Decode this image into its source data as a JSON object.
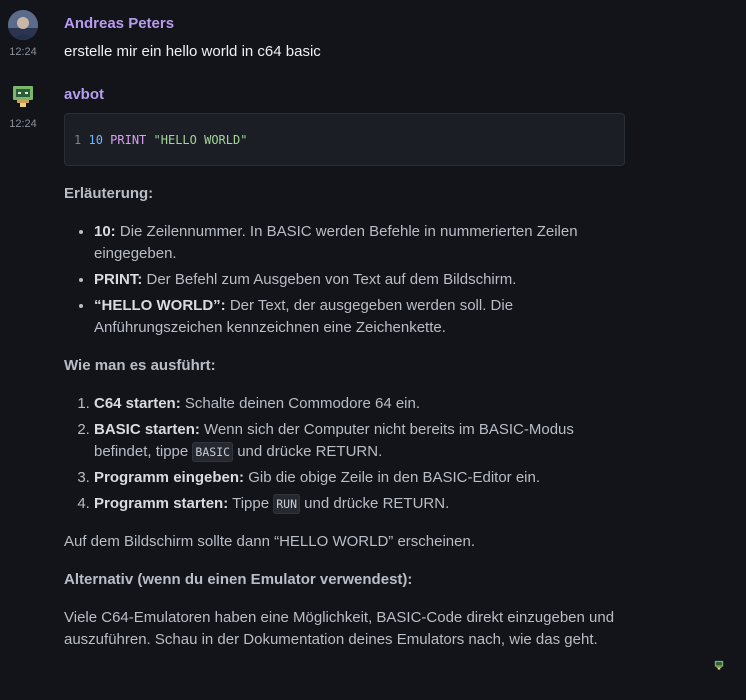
{
  "messages": {
    "user": {
      "sender": "Andreas Peters",
      "time": "12:24",
      "text": "erstelle mir ein hello world in c64 basic"
    },
    "bot": {
      "sender": "avbot",
      "time": "12:24",
      "code": {
        "line_number": "1",
        "number": "10",
        "keyword": "PRINT",
        "string": "\"HELLO WORLD\""
      },
      "heading_explanation": "Erläuterung:",
      "explanation_items": [
        {
          "term": "10:",
          "text": " Die Zeilennummer. In BASIC werden Befehle in nummerierten Zeilen eingegeben."
        },
        {
          "term": "PRINT:",
          "text": " Der Befehl zum Ausgeben von Text auf dem Bildschirm."
        },
        {
          "term": "“HELLO WORLD”:",
          "text": " Der Text, der ausgegeben werden soll. Die Anführungszeichen kennzeichnen eine Zeichenkette."
        }
      ],
      "heading_run": "Wie man es ausführt:",
      "steps": [
        {
          "term": "C64 starten:",
          "text": " Schalte deinen Commodore 64 ein."
        },
        {
          "term": "BASIC starten:",
          "text_before": " Wenn sich der Computer nicht bereits im BASIC-Modus befindet, tippe ",
          "code": "BASIC",
          "text_after": " und drücke RETURN."
        },
        {
          "term": "Programm eingeben:",
          "text": " Gib die obige Zeile in den BASIC-Editor ein."
        },
        {
          "term": "Programm starten:",
          "text_before": " Tippe ",
          "code": "RUN",
          "text_after": " und drücke RETURN."
        }
      ],
      "result_text": "Auf dem Bildschirm sollte dann “HELLO WORLD” erscheinen.",
      "heading_alt": "Alternativ (wenn du einen Emulator verwendest):",
      "alt_text": "Viele C64-Emulatoren haben eine Möglichkeit, BASIC-Code direkt einzugeben und auszuführen. Schau in der Dokumentation deines Emulators nach, wie das geht."
    }
  },
  "colors": {
    "background": "#121419",
    "sender_name": "#b79cf0",
    "code_background": "#1b1e24"
  }
}
